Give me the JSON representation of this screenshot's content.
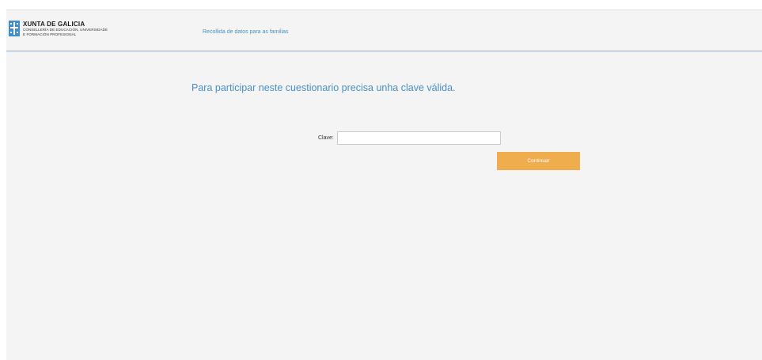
{
  "header": {
    "logo": {
      "name": "XUNTA DE GALICIA",
      "line1": "CONSELLERÍA DE EDUCACIÓN, UNIVERSIDADE",
      "line2": "E FORMACIÓN PROFESIONAL",
      "icon": "xunta-cross-logo-icon",
      "color": "#3f8fd0"
    },
    "app_title": "Recollida de datos para as familias"
  },
  "main": {
    "heading": "Para participar neste cuestionario precisa unha clave válida.",
    "key_label": "Clave:",
    "key_value": "",
    "continue_label": "Continuar"
  },
  "colors": {
    "accent": "#4a90c4",
    "button": "#f0ad4e",
    "background": "#f4f4f4"
  }
}
